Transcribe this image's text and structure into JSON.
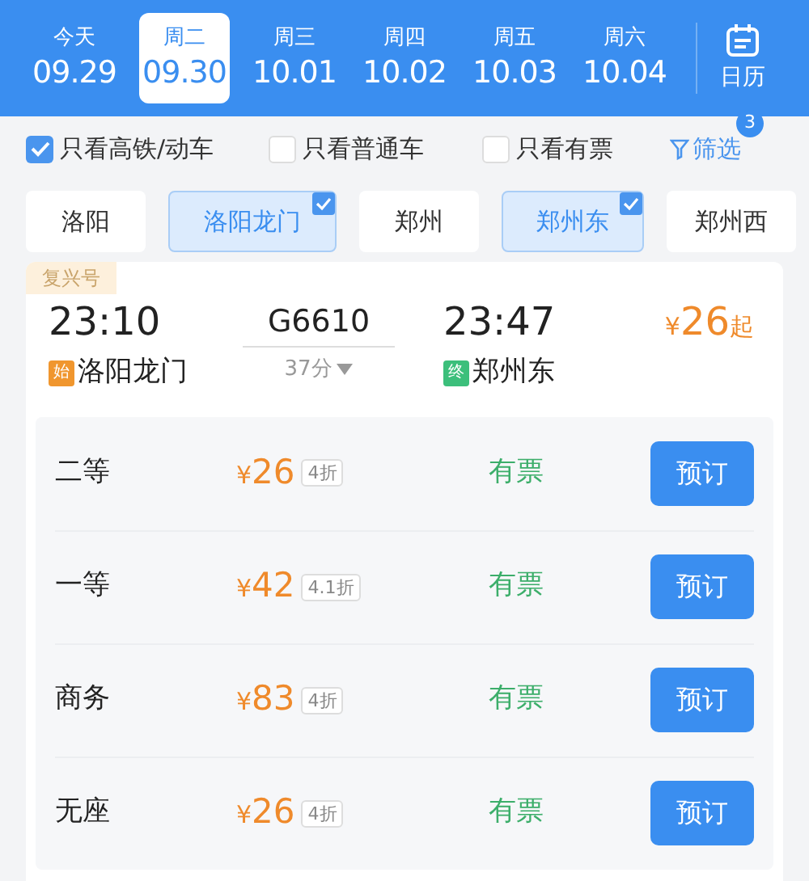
{
  "date_tabs": [
    {
      "weekday": "今天",
      "date": "09.29",
      "selected": false
    },
    {
      "weekday": "周二",
      "date": "09.30",
      "selected": true
    },
    {
      "weekday": "周三",
      "date": "10.01",
      "selected": false
    },
    {
      "weekday": "周四",
      "date": "10.02",
      "selected": false
    },
    {
      "weekday": "周五",
      "date": "10.03",
      "selected": false
    },
    {
      "weekday": "周六",
      "date": "10.04",
      "selected": false
    }
  ],
  "calendar_button": {
    "label": "日历"
  },
  "filters": [
    {
      "label": "只看高铁/动车",
      "checked": true
    },
    {
      "label": "只看普通车",
      "checked": false
    },
    {
      "label": "只看有票",
      "checked": false
    }
  ],
  "filter_button": {
    "label": "筛选",
    "badge": "3"
  },
  "stations": [
    {
      "label": "洛阳",
      "selected": false
    },
    {
      "label": "洛阳龙门",
      "selected": true
    },
    {
      "label": "郑州",
      "selected": false
    },
    {
      "label": "郑州东",
      "selected": true
    },
    {
      "label": "郑州西",
      "selected": false
    }
  ],
  "train": {
    "tag": "复兴号",
    "depart_time": "23:10",
    "number": "G6610",
    "arrive_time": "23:47",
    "duration": "37分",
    "price_symbol": "¥",
    "price": "26",
    "price_suffix": "起",
    "origin_badge": "始",
    "origin": "洛阳龙门",
    "dest_badge": "终",
    "destination": "郑州东"
  },
  "seats": [
    {
      "class": "二等",
      "price_symbol": "¥",
      "price": "26",
      "discount": "4折",
      "availability": "有票",
      "button": "预订"
    },
    {
      "class": "一等",
      "price_symbol": "¥",
      "price": "42",
      "discount": "4.1折",
      "availability": "有票",
      "button": "预订"
    },
    {
      "class": "商务",
      "price_symbol": "¥",
      "price": "83",
      "discount": "4折",
      "availability": "有票",
      "button": "预订"
    },
    {
      "class": "无座",
      "price_symbol": "¥",
      "price": "26",
      "discount": "4折",
      "availability": "有票",
      "button": "预订"
    }
  ]
}
